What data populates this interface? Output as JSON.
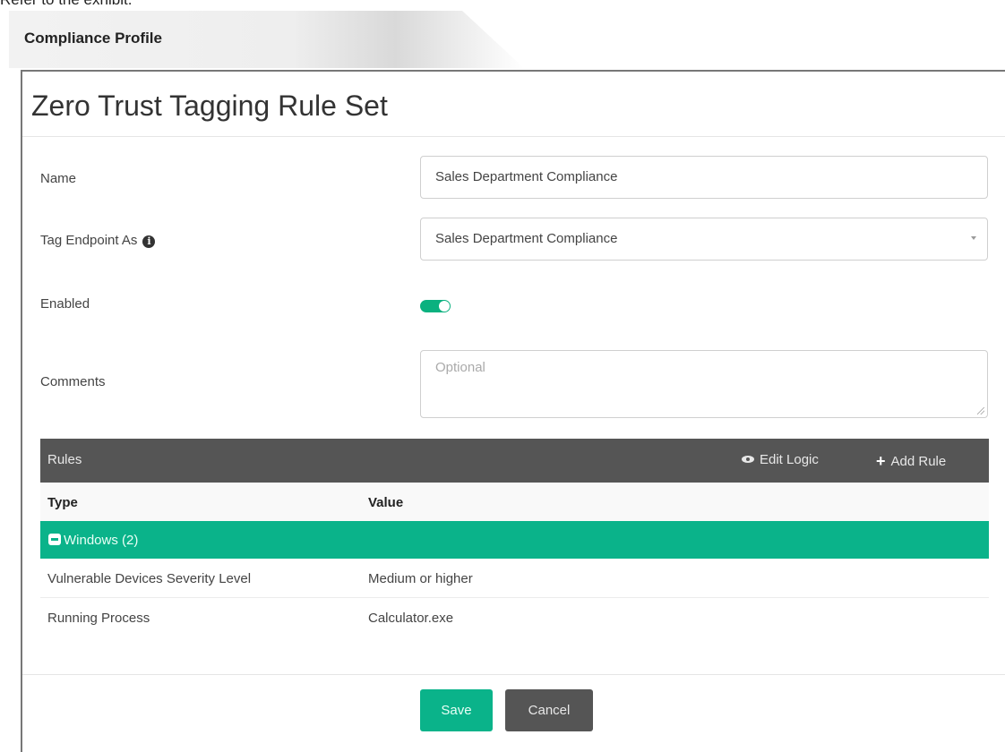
{
  "caption": "Refer to the exhibit.",
  "tab": {
    "title": "Compliance Profile"
  },
  "panel": {
    "title": "Zero Trust Tagging Rule Set"
  },
  "form": {
    "name_label": "Name",
    "name_value": "Sales Department Compliance",
    "tag_label": "Tag Endpoint As",
    "tag_value": "Sales Department Compliance",
    "enabled_label": "Enabled",
    "enabled": true,
    "comments_label": "Comments",
    "comments_placeholder": "Optional"
  },
  "rules": {
    "title": "Rules",
    "edit_logic_label": "Edit Logic",
    "add_rule_label": "Add Rule",
    "columns": [
      "Type",
      "Value"
    ],
    "group": {
      "label": "Windows (2)"
    },
    "rows": [
      {
        "type": "Vulnerable Devices Severity Level",
        "value": "Medium or higher"
      },
      {
        "type": "Running Process",
        "value": "Calculator.exe"
      }
    ]
  },
  "actions": {
    "save_label": "Save",
    "cancel_label": "Cancel"
  },
  "colors": {
    "accent": "#0ab38a",
    "bar": "#555555"
  }
}
